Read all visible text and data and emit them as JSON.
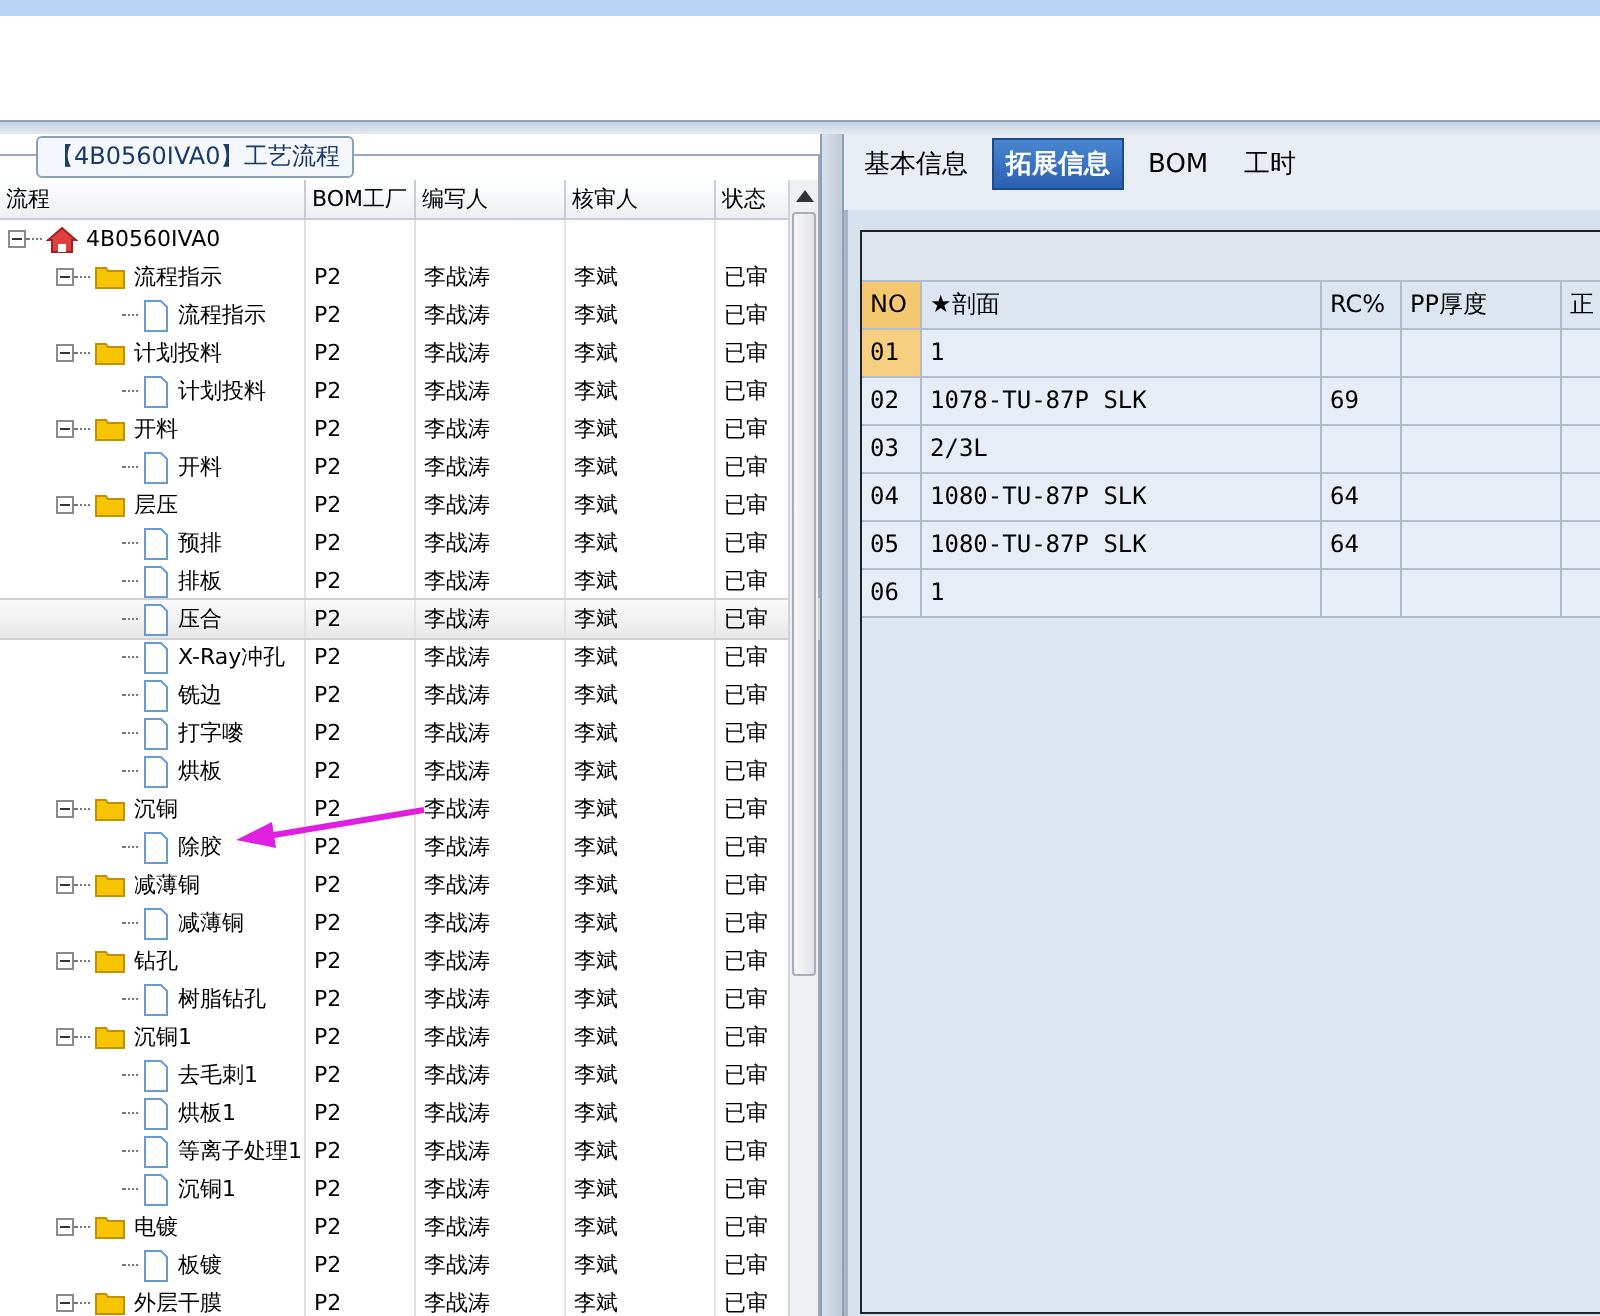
{
  "left_panel": {
    "title": "【4B0560IVA0】工艺流程",
    "columns": [
      "流程",
      "BOM工厂",
      "编写人",
      "核审人",
      "状态"
    ],
    "tree": [
      {
        "label": "4B0560IVA0",
        "kind": "root",
        "expanded": true,
        "selected": false,
        "children": [
          {
            "label": "流程指示",
            "kind": "folder",
            "expanded": true,
            "selected": false,
            "factory": "P2",
            "author": "李战涛",
            "reviewer": "李斌",
            "status": "已审",
            "children": [
              {
                "label": "流程指示",
                "kind": "file",
                "selected": false,
                "factory": "P2",
                "author": "李战涛",
                "reviewer": "李斌",
                "status": "已审"
              }
            ]
          },
          {
            "label": "计划投料",
            "kind": "folder",
            "expanded": true,
            "selected": false,
            "factory": "P2",
            "author": "李战涛",
            "reviewer": "李斌",
            "status": "已审",
            "children": [
              {
                "label": "计划投料",
                "kind": "file",
                "selected": false,
                "factory": "P2",
                "author": "李战涛",
                "reviewer": "李斌",
                "status": "已审"
              }
            ]
          },
          {
            "label": "开料",
            "kind": "folder",
            "expanded": true,
            "selected": false,
            "factory": "P2",
            "author": "李战涛",
            "reviewer": "李斌",
            "status": "已审",
            "children": [
              {
                "label": "开料",
                "kind": "file",
                "selected": false,
                "factory": "P2",
                "author": "李战涛",
                "reviewer": "李斌",
                "status": "已审"
              }
            ]
          },
          {
            "label": "层压",
            "kind": "folder",
            "expanded": true,
            "selected": false,
            "factory": "P2",
            "author": "李战涛",
            "reviewer": "李斌",
            "status": "已审",
            "children": [
              {
                "label": "预排",
                "kind": "file",
                "selected": false,
                "factory": "P2",
                "author": "李战涛",
                "reviewer": "李斌",
                "status": "已审"
              },
              {
                "label": "排板",
                "kind": "file",
                "selected": false,
                "factory": "P2",
                "author": "李战涛",
                "reviewer": "李斌",
                "status": "已审"
              },
              {
                "label": "压合",
                "kind": "file",
                "selected": true,
                "factory": "P2",
                "author": "李战涛",
                "reviewer": "李斌",
                "status": "已审"
              },
              {
                "label": "X-Ray冲孔",
                "kind": "file",
                "selected": false,
                "factory": "P2",
                "author": "李战涛",
                "reviewer": "李斌",
                "status": "已审"
              },
              {
                "label": "铣边",
                "kind": "file",
                "selected": false,
                "factory": "P2",
                "author": "李战涛",
                "reviewer": "李斌",
                "status": "已审"
              },
              {
                "label": "打字嘜",
                "kind": "file",
                "selected": false,
                "factory": "P2",
                "author": "李战涛",
                "reviewer": "李斌",
                "status": "已审"
              },
              {
                "label": "烘板",
                "kind": "file",
                "selected": false,
                "factory": "P2",
                "author": "李战涛",
                "reviewer": "李斌",
                "status": "已审"
              }
            ]
          },
          {
            "label": "沉铜",
            "kind": "folder",
            "expanded": true,
            "selected": false,
            "factory": "P2",
            "author": "李战涛",
            "reviewer": "李斌",
            "status": "已审",
            "children": [
              {
                "label": "除胶",
                "kind": "file",
                "selected": false,
                "factory": "P2",
                "author": "李战涛",
                "reviewer": "李斌",
                "status": "已审"
              }
            ]
          },
          {
            "label": "减薄铜",
            "kind": "folder",
            "expanded": true,
            "selected": false,
            "factory": "P2",
            "author": "李战涛",
            "reviewer": "李斌",
            "status": "已审",
            "children": [
              {
                "label": "减薄铜",
                "kind": "file",
                "selected": false,
                "factory": "P2",
                "author": "李战涛",
                "reviewer": "李斌",
                "status": "已审"
              }
            ]
          },
          {
            "label": "钻孔",
            "kind": "folder",
            "expanded": true,
            "selected": false,
            "factory": "P2",
            "author": "李战涛",
            "reviewer": "李斌",
            "status": "已审",
            "children": [
              {
                "label": "树脂钻孔",
                "kind": "file",
                "selected": false,
                "factory": "P2",
                "author": "李战涛",
                "reviewer": "李斌",
                "status": "已审"
              }
            ]
          },
          {
            "label": "沉铜1",
            "kind": "folder",
            "expanded": true,
            "selected": false,
            "factory": "P2",
            "author": "李战涛",
            "reviewer": "李斌",
            "status": "已审",
            "children": [
              {
                "label": "去毛刺1",
                "kind": "file",
                "selected": false,
                "factory": "P2",
                "author": "李战涛",
                "reviewer": "李斌",
                "status": "已审"
              },
              {
                "label": "烘板1",
                "kind": "file",
                "selected": false,
                "factory": "P2",
                "author": "李战涛",
                "reviewer": "李斌",
                "status": "已审"
              },
              {
                "label": "等离子处理1",
                "kind": "file",
                "selected": false,
                "factory": "P2",
                "author": "李战涛",
                "reviewer": "李斌",
                "status": "已审"
              },
              {
                "label": "沉铜1",
                "kind": "file",
                "selected": false,
                "factory": "P2",
                "author": "李战涛",
                "reviewer": "李斌",
                "status": "已审"
              }
            ]
          },
          {
            "label": "电镀",
            "kind": "folder",
            "expanded": true,
            "selected": false,
            "factory": "P2",
            "author": "李战涛",
            "reviewer": "李斌",
            "status": "已审",
            "children": [
              {
                "label": "板镀",
                "kind": "file",
                "selected": false,
                "factory": "P2",
                "author": "李战涛",
                "reviewer": "李斌",
                "status": "已审"
              }
            ]
          },
          {
            "label": "外层干膜",
            "kind": "folder",
            "expanded": true,
            "selected": false,
            "factory": "P2",
            "author": "李战涛",
            "reviewer": "李斌",
            "status": "已审"
          }
        ]
      }
    ]
  },
  "right_panel": {
    "tabs": [
      {
        "label": "基本信息",
        "selected": false
      },
      {
        "label": "拓展信息",
        "selected": true
      },
      {
        "label": "BOM",
        "selected": false
      },
      {
        "label": "工时",
        "selected": false
      }
    ],
    "table": {
      "columns": [
        "NO",
        "★剖面",
        "RC%",
        "PP厚度",
        "正"
      ],
      "rows": [
        {
          "no": "01",
          "section": "1",
          "rc": "",
          "selected": true
        },
        {
          "no": "02",
          "section": "1078-TU-87P SLK",
          "rc": "69",
          "selected": false
        },
        {
          "no": "03",
          "section": "2/3L",
          "rc": "",
          "selected": false
        },
        {
          "no": "04",
          "section": "1080-TU-87P SLK",
          "rc": "64",
          "selected": false
        },
        {
          "no": "05",
          "section": "1080-TU-87P SLK",
          "rc": "64",
          "selected": false
        },
        {
          "no": "06",
          "section": "1",
          "rc": "",
          "selected": false
        }
      ]
    }
  }
}
